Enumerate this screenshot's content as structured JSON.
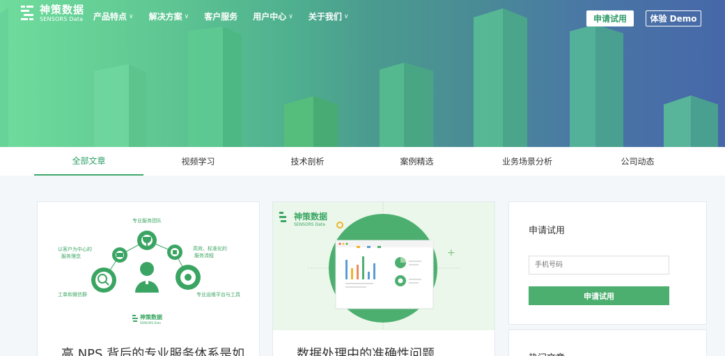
{
  "logo": {
    "name_cn": "神策数据",
    "name_en": "SENSORS Data"
  },
  "nav": [
    {
      "label": "产品特点",
      "has_dropdown": true
    },
    {
      "label": "解决方案",
      "has_dropdown": true
    },
    {
      "label": "客户服务",
      "has_dropdown": false
    },
    {
      "label": "用户中心",
      "has_dropdown": true
    },
    {
      "label": "关于我们",
      "has_dropdown": true
    }
  ],
  "header_buttons": {
    "trial": "申请试用",
    "demo": "体验 Demo"
  },
  "tabs": [
    "全部文章",
    "视频学习",
    "技术剖析",
    "案例精选",
    "业务场景分析",
    "公司动态"
  ],
  "active_tab": "全部文章",
  "articles": [
    {
      "title": "高 NPS 背后的专业服务体系是如",
      "diagram": {
        "top": "专业服务团队",
        "left": "以客户为中心的\n服务理念",
        "right": "高效、标准化的\n服务流程",
        "bottom_left": "工单和微信群",
        "bottom_right": "专业运维平台与工具",
        "logo_cn": "神策数据",
        "logo_en": "SENSORS Data"
      }
    },
    {
      "title": "数据处理中的准确性问题",
      "image_logo_cn": "神策数据",
      "image_logo_en": "SENSORS Data"
    }
  ],
  "sidebar": {
    "trial_title": "申请试用",
    "phone_placeholder": "手机号码",
    "trial_button": "申请试用",
    "hot_title": "热门文章"
  },
  "colors": {
    "brand_green": "#4caf6f",
    "active_tab": "#2b9f66",
    "hero_blue": "#4667a9"
  }
}
